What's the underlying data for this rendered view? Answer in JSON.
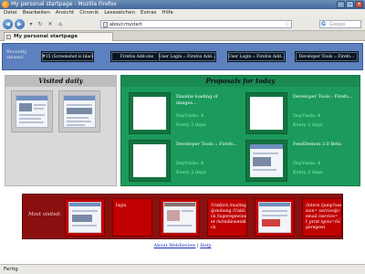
{
  "window": {
    "title": "My personal startpage - Mozilla Firefox"
  },
  "menu": [
    "Datei",
    "Bearbeiten",
    "Ansicht",
    "Chronik",
    "Lesezeichen",
    "Extras",
    "Hilfe"
  ],
  "nav": {
    "url": "about:mystart",
    "search_placeholder": "Google"
  },
  "tab": {
    "label": "My personal startpage"
  },
  "recently": {
    "label": "Recently viewed:",
    "items": [
      "#15 (Screenshot is black/...",
      "Firefox Add-ons",
      "User Login :: Firefox Add...",
      "User Login :: Firefox Add...",
      "Developer Tools :: Firefo..."
    ]
  },
  "visited_daily": {
    "title": "Visited daily"
  },
  "proposals": {
    "title": "Proposals for today",
    "cards": [
      {
        "title": "Disable loading of images...",
        "visits": "DayVisits: 4",
        "freq": "Every 2 days"
      },
      {
        "title": "Developer Tools : Firefo...",
        "visits": "DayVisits: 4",
        "freq": "Every 2 days"
      },
      {
        "title": "Developer Tools :: Firefo...",
        "visits": "DayVisits: 4",
        "freq": "Every 2 days"
      },
      {
        "title": "FeedDemon 3.0 Beta",
        "visits": "DayVisits: 4",
        "freq": "Every 2 days"
      }
    ]
  },
  "most_visited": {
    "label": "Most visited:",
    "text_items": [
      "login",
      "/Unklick /mailing@ziehung /Unklick /lugeregewinner /w/millionenklick",
      "/intern /jump?session= service@remail /service=__f_print /goto=/lugeregewi"
    ]
  },
  "footer": {
    "about": "About WebReview",
    "separator": "|",
    "help": "Help"
  },
  "status": {
    "text": "Fertig"
  }
}
